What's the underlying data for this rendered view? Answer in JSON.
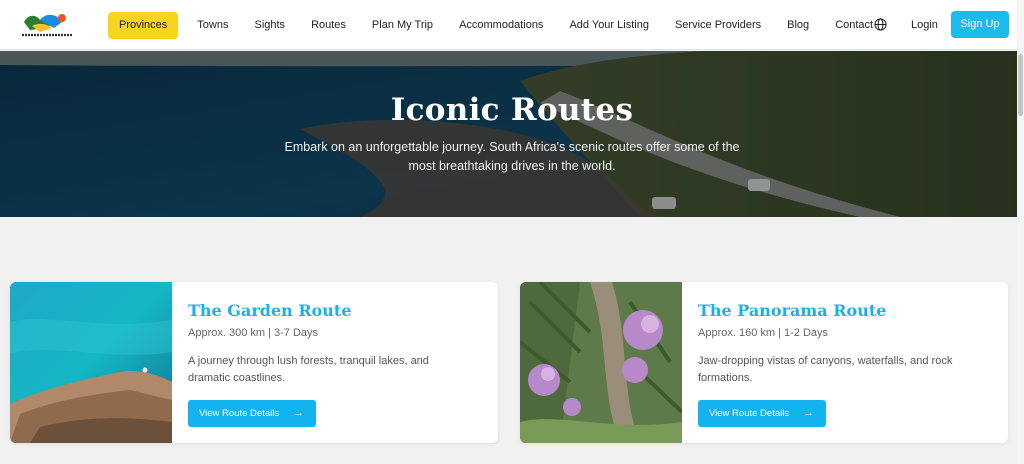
{
  "logo": {
    "caption": "travelingsouthafrica.co.za"
  },
  "nav": {
    "items": [
      {
        "label": "Provinces",
        "active": true
      },
      {
        "label": "Towns"
      },
      {
        "label": "Sights"
      },
      {
        "label": "Routes"
      },
      {
        "label": "Plan My Trip"
      },
      {
        "label": "Accommodations"
      },
      {
        "label": "Add Your Listing"
      },
      {
        "label": "Service Providers"
      },
      {
        "label": "Blog"
      },
      {
        "label": "Contact"
      }
    ],
    "globe_icon": "globe-icon",
    "login_label": "Login",
    "signup_label": "Sign Up"
  },
  "hero": {
    "title": "Iconic Routes",
    "subtitle": "Embark on an unforgettable journey. South Africa's scenic routes offer some of the most breathtaking drives in the world."
  },
  "routes": [
    {
      "title": "The Garden Route",
      "meta": "Approx. 300 km | 3-7 Days",
      "description": "A journey through lush forests, tranquil lakes, and dramatic coastlines.",
      "button_label": "View Route Details",
      "button_icon": "arrow-right-icon"
    },
    {
      "title": "The Panorama Route",
      "meta": "Approx. 160 km | 1-2 Days",
      "description": "Jaw-dropping vistas of canyons, waterfalls, and rock formations.",
      "button_label": "View Route Details",
      "button_icon": "arrow-right-icon"
    }
  ],
  "colors": {
    "accent_yellow": "#f7d51d",
    "accent_blue": "#1bbbf0",
    "title_blue": "#1bb0e6"
  }
}
